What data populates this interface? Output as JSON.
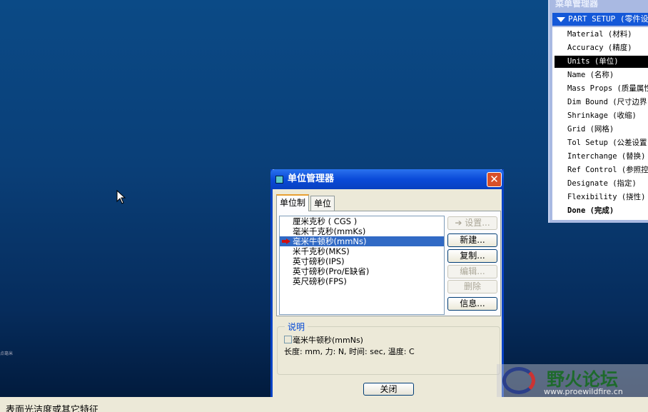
{
  "menu_manager": {
    "title": "菜单管理器",
    "header": "PART SETUP (零件设置)",
    "items": [
      {
        "label": "Material (材料)"
      },
      {
        "label": "Accuracy (精度)"
      },
      {
        "label": "Units (单位)",
        "selected": true
      },
      {
        "label": "Name (名称)"
      },
      {
        "label": "Mass Props (质量属性)"
      },
      {
        "label": "Dim Bound (尺寸边界)"
      },
      {
        "label": "Shrinkage (收缩)"
      },
      {
        "label": "Grid (网格)"
      },
      {
        "label": "Tol Setup (公差设置)"
      },
      {
        "label": "Interchange (替换)"
      },
      {
        "label": "Ref Control (参照控制)"
      },
      {
        "label": "Designate (指定)"
      },
      {
        "label": "Flexibility (挠性)"
      },
      {
        "label": "Done (完成)",
        "bold": true
      }
    ]
  },
  "dialog": {
    "title": "单位管理器",
    "tabs": [
      {
        "label": "单位制"
      },
      {
        "label": "单位"
      }
    ],
    "systems": [
      {
        "label": "厘米克秒 ( CGS )"
      },
      {
        "label": "毫米千克秒(mmKs)"
      },
      {
        "label": "毫米牛顿秒(mmNs)",
        "selected": true
      },
      {
        "label": "米千克秒(MKS)"
      },
      {
        "label": "英寸磅秒(IPS)"
      },
      {
        "label": "英寸磅秒(Pro/E缺省)"
      },
      {
        "label": "英尺磅秒(FPS)"
      }
    ],
    "buttons": {
      "set": "➔ 设置...",
      "new": "新建...",
      "copy": "复制...",
      "edit": "编辑...",
      "delete": "删除",
      "info": "信息..."
    },
    "description": {
      "label": "说明",
      "name": "毫米牛顿秒(mmNs)",
      "details": "长度: mm, 力: N, 时间: sec, 温度: C"
    },
    "close": "关闭"
  },
  "status_text": "表面光洁度或其它特征",
  "corner_text": "点毫米",
  "watermark": {
    "title": "野火论坛",
    "url": "www.proewildfire.cn"
  },
  "colors": {
    "titlebar": "#0a4ad8",
    "selection": "#316ac5",
    "menu_header": "#1458d8"
  }
}
